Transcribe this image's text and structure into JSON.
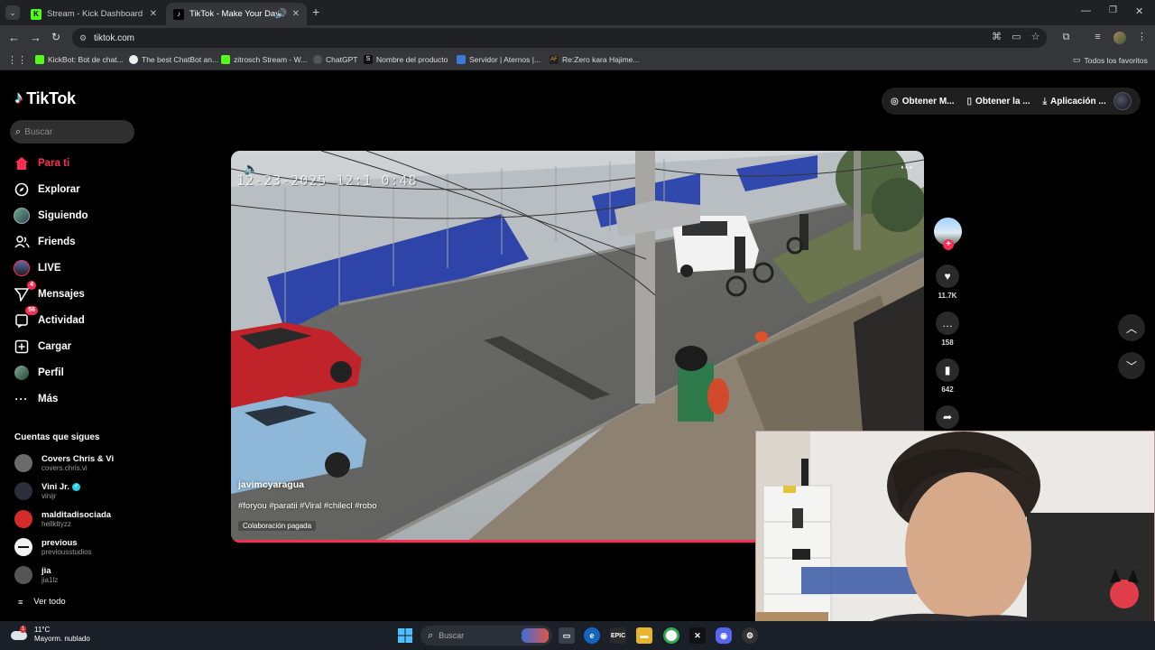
{
  "browser": {
    "tabs": [
      {
        "title": "Stream - Kick Dashboard",
        "favicon": "kick-icon",
        "active": false
      },
      {
        "title": "TikTok - Make Your Day",
        "favicon": "tiktok-icon",
        "active": true
      }
    ],
    "url": "tiktok.com",
    "bookmarks": [
      {
        "label": "KickBot: Bot de chat...",
        "favicon": "kick-icon"
      },
      {
        "label": "The best ChatBot an...",
        "favicon": "chatbot-icon"
      },
      {
        "label": "zitrosch Stream - W...",
        "favicon": "kick-icon"
      },
      {
        "label": "ChatGPT",
        "favicon": "chatgpt-icon"
      },
      {
        "label": "Nombre del producto",
        "favicon": "s-icon"
      },
      {
        "label": "Servidor | Aternos |...",
        "favicon": "aternos-icon"
      },
      {
        "label": "Re:Zero kara Hajime...",
        "favicon": "af-icon"
      }
    ],
    "all_bookmarks_label": "Todos los favoritos"
  },
  "tiktok": {
    "brand": "TikTok",
    "search_placeholder": "Buscar",
    "nav": [
      {
        "label": "Para ti",
        "icon": "home-icon",
        "active": true,
        "badge": ""
      },
      {
        "label": "Explorar",
        "icon": "compass-icon",
        "active": false,
        "badge": ""
      },
      {
        "label": "Siguiendo",
        "icon": "following-avatar-icon",
        "active": false,
        "badge": ""
      },
      {
        "label": "Friends",
        "icon": "friends-icon",
        "active": false,
        "badge": ""
      },
      {
        "label": "LIVE",
        "icon": "live-icon",
        "active": false,
        "badge": ""
      },
      {
        "label": "Mensajes",
        "icon": "send-icon",
        "active": false,
        "badge": "4"
      },
      {
        "label": "Actividad",
        "icon": "activity-icon",
        "active": false,
        "badge": "56"
      },
      {
        "label": "Cargar",
        "icon": "upload-icon",
        "active": false,
        "badge": ""
      },
      {
        "label": "Perfil",
        "icon": "profile-icon",
        "active": false,
        "badge": ""
      },
      {
        "label": "Más",
        "icon": "more-icon",
        "active": false,
        "badge": ""
      }
    ],
    "following_heading": "Cuentas que sigues",
    "following": [
      {
        "name": "Covers Chris & Vi",
        "handle": "covers.chris.vi",
        "verified": false,
        "color": "#6b6b6b"
      },
      {
        "name": "Vini Jr.",
        "handle": "vinijr",
        "verified": true,
        "color": "#2e2e3a"
      },
      {
        "name": "malditadisociada",
        "handle": "hellkttyzz",
        "verified": false,
        "color": "#d42b2b"
      },
      {
        "name": "previous",
        "handle": "previousstudios",
        "verified": false,
        "color": "#f2f2f2"
      },
      {
        "name": "jia",
        "handle": "jia1lz",
        "verified": false,
        "color": "#555555"
      }
    ],
    "see_all": "Ver todo",
    "header_actions": [
      {
        "label": "Obtener M...",
        "icon": "coin-icon"
      },
      {
        "label": "Obtener la ...",
        "icon": "phone-icon"
      },
      {
        "label": "Aplicación ...",
        "icon": "download-icon"
      }
    ],
    "video": {
      "username": "javimcyaragua",
      "hashtags": "#foryou #paratii #Viral #chilecl #robo",
      "paid_label": "Colaboración pagada",
      "cam_timestamp": "12-23-2025 12:1 0:48",
      "progress": 0.76
    },
    "actions": {
      "likes": "11.7K",
      "comments": "158",
      "saves": "642"
    }
  },
  "taskbar": {
    "temperature": "11°C",
    "weather": "Mayorm. nublado",
    "weather_badge": "1",
    "search_placeholder": "Buscar"
  },
  "colors": {
    "accent": "#fe2c55",
    "background": "#000000",
    "chrome_dark": "#202124",
    "chrome_toolbar": "#35363a"
  }
}
